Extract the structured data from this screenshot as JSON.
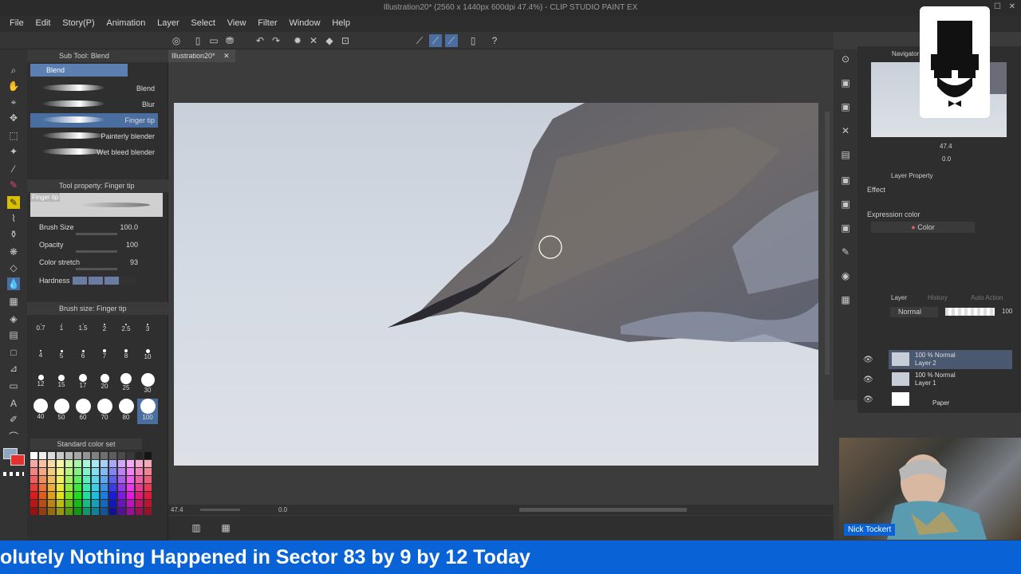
{
  "window": {
    "title": "Illustration20* (2560 x 1440px 600dpi 47.4%) - CLIP STUDIO PAINT EX"
  },
  "menu": [
    "File",
    "Edit",
    "Story(P)",
    "Animation",
    "Layer",
    "Select",
    "View",
    "Filter",
    "Window",
    "Help"
  ],
  "sub_tool": {
    "header": "Sub Tool: Blend",
    "group": "Blend",
    "items": [
      "Blend",
      "Blur",
      "Finger tip",
      "Painterly blender",
      "Wet bleed blender"
    ],
    "selected": "Finger tip"
  },
  "tool_property": {
    "header": "Tool property: Finger tip",
    "preview_label": "Finger tip",
    "brush_size_label": "Brush Size",
    "brush_size": "100.0",
    "opacity_label": "Opacity",
    "opacity": "100",
    "color_stretch_label": "Color stretch",
    "color_stretch": "93",
    "hardness_label": "Hardness"
  },
  "brush_size_panel": {
    "header": "Brush size: Finger tip",
    "sizes": [
      "0.7",
      "1",
      "1.5",
      "2",
      "2.5",
      "3",
      "4",
      "5",
      "6",
      "7",
      "8",
      "10",
      "12",
      "15",
      "17",
      "20",
      "25",
      "30",
      "40",
      "50",
      "60",
      "70",
      "80",
      "100"
    ]
  },
  "color_set": {
    "label": "Standard color set"
  },
  "document": {
    "tab": "Illustration20*"
  },
  "status": {
    "zoom": "47.4",
    "angle": "0.0"
  },
  "navigator": {
    "label": "Navigator",
    "zoom": "47.4",
    "angle": "0.0"
  },
  "layer_property": {
    "header": "Layer Property",
    "effect": "Effect",
    "expression_color_label": "Expression color",
    "expression_color": "Color"
  },
  "layer_panel": {
    "tabs": [
      "Layer",
      "History",
      "Auto Action"
    ],
    "blend_mode": "Normal",
    "opacity": "100",
    "layers": [
      {
        "info": "100 % Normal",
        "name": "Layer 2"
      },
      {
        "info": "100 % Normal",
        "name": "Layer 1"
      },
      {
        "info": "",
        "name": "Paper"
      }
    ]
  },
  "webcam": {
    "name": "Nick Tockert"
  },
  "ticker": {
    "text": "olutely Nothing Happened in Sector 83 by 9 by 12 Today"
  },
  "colors": {
    "accent": "#4a6ea0",
    "ticker_bg": "#0a63d6"
  }
}
